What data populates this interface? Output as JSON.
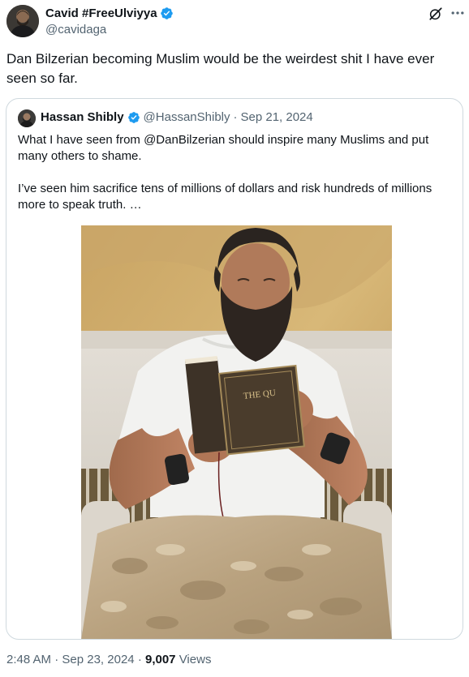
{
  "author": {
    "name": "Cavid #FreeUlviyya",
    "handle": "@cavidaga"
  },
  "tweet": {
    "text": "Dan Bilzerian becoming Muslim would be the weirdest shit I have ever seen so far."
  },
  "quoted": {
    "name": "Hassan Shibly",
    "handle": "@HassanShibly",
    "separator": "·",
    "date": "Sep 21, 2024",
    "paragraph1": "What I have seen from @DanBilzerian should inspire many Muslims and put many others to shame.",
    "paragraph2": "I’ve seen him sacrifice tens of millions of dollars and risk hundreds of millions more to speak truth. …",
    "image_book_title": "THE QU"
  },
  "footer": {
    "time": "2:48 AM",
    "sep1": "·",
    "date": "Sep 23, 2024",
    "sep2": "·",
    "views_count": "9,007",
    "views_label": "Views"
  },
  "colors": {
    "verified": "#1d9bf0",
    "secondary_text": "#536471",
    "border": "#cfd9de"
  },
  "icons": [
    "verified-badge-icon",
    "grok-icon",
    "more-icon"
  ]
}
